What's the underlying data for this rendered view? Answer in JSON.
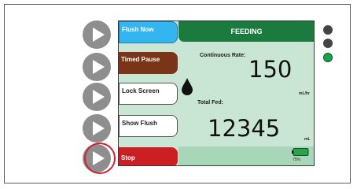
{
  "softkeys": [
    {
      "label": "Flush Now",
      "color": "#33b5f0"
    },
    {
      "label": "Timed Pause",
      "color": "#7a3417"
    },
    {
      "label": "Lock Screen",
      "color": "#ffffff"
    },
    {
      "label": "Show Flush",
      "color": "#ffffff"
    },
    {
      "label": "Stop",
      "color": "#cc1f24"
    }
  ],
  "header": {
    "title": "FEEDING",
    "color": "#1b7a3e"
  },
  "rate": {
    "label": "Continuous Rate:",
    "value": "150",
    "unit": "mL/hr"
  },
  "total": {
    "label": "Total Fed:",
    "value": "12345",
    "unit": "mL"
  },
  "battery": {
    "percent": "75%",
    "color": "#24a64a"
  },
  "indicators": [
    {
      "state": "off",
      "color": "#444444"
    },
    {
      "state": "off",
      "color": "#444444"
    },
    {
      "state": "on",
      "color": "#17a24b"
    }
  ],
  "icons": {
    "side_buttons": "play-icon",
    "drop": "drop-icon",
    "battery": "battery-icon"
  },
  "highlight": {
    "target": "play-button-5",
    "color": "#d61e32"
  }
}
